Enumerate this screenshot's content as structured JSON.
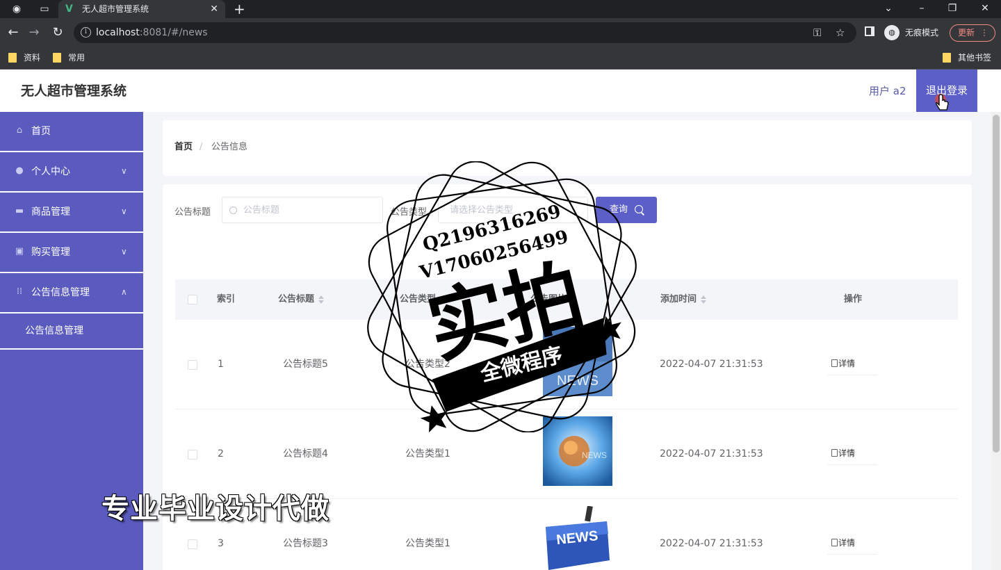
{
  "browser": {
    "tab_title": "无人超市管理系统",
    "url_host": "localhost",
    "url_rest": ":8081/#/news",
    "incognito_label": "无痕模式",
    "update_label": "更新",
    "bookmarks": [
      "资料",
      "常用"
    ],
    "other_bookmarks": "其他书签"
  },
  "header": {
    "app_title": "无人超市管理系统",
    "user_label": "用户 a2",
    "logout_label": "退出登录"
  },
  "sidebar": {
    "items": [
      {
        "label": "首页",
        "icon": "home-icon"
      },
      {
        "label": "个人中心",
        "icon": "user-icon"
      },
      {
        "label": "商品管理",
        "icon": "goods-icon"
      },
      {
        "label": "购买管理",
        "icon": "purchase-icon"
      },
      {
        "label": "公告信息管理",
        "icon": "notice-icon"
      }
    ],
    "submenu": "公告信息管理"
  },
  "breadcrumb": {
    "home": "首页",
    "separator": "/",
    "current": "公告信息"
  },
  "filters": {
    "title_label": "公告标题",
    "title_placeholder": "公告标题",
    "type_label": "公告类型",
    "type_placeholder": "请选择公告类型",
    "query_label": "查询"
  },
  "table": {
    "columns": [
      "索引",
      "公告标题",
      "公告类型",
      "公告图片",
      "添加时间",
      "操作"
    ],
    "rows": [
      {
        "index": "1",
        "title": "公告标题5",
        "type": "公告类型2",
        "image_text": "NEWS",
        "time": "2022-04-07 21:31:53",
        "action": "详情"
      },
      {
        "index": "2",
        "title": "公告标题4",
        "type": "公告类型1",
        "image_text": "NEWS",
        "time": "2022-04-07 21:31:53",
        "action": "详情"
      },
      {
        "index": "3",
        "title": "公告标题3",
        "type": "公告类型1",
        "image_text": "NEWS",
        "time": "2022-04-07 21:31:53",
        "action": "详情"
      }
    ]
  },
  "overlay": {
    "watermark": "专业毕业设计代做",
    "stamp_qq": "Q2196316269",
    "stamp_wechat": "V17060256499",
    "stamp_main": "实拍",
    "stamp_banner": "全微程序"
  },
  "colors": {
    "sidebar": "#5b5bbf",
    "primary": "#5b5fc7",
    "browser_dark": "#202124"
  }
}
